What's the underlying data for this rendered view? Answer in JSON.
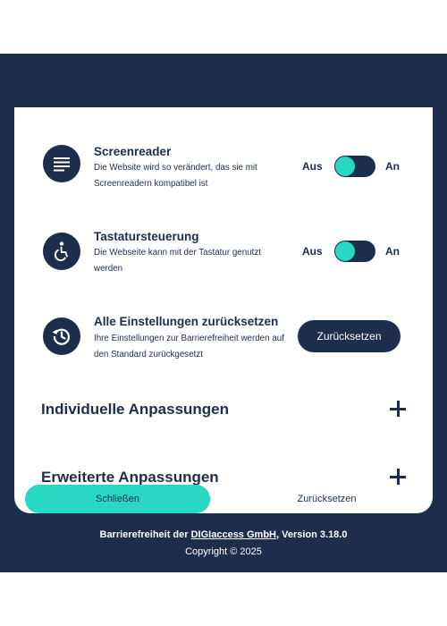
{
  "settings": {
    "screenreader": {
      "title": "Screenreader",
      "description": "Die Website wird so verändert, das sie mit Screenreadern kompatibel ist",
      "off_label": "Aus",
      "on_label": "An"
    },
    "keyboard": {
      "title": "Tastatursteuerung",
      "description": "Die Webseite kann mit der Tastatur genutzt werden",
      "off_label": "Aus",
      "on_label": "An"
    },
    "reset_all": {
      "title": "Alle Einstellungen zurücksetzen",
      "description": "Ihre Einstellungen zur Barrierefreiheit werden auf den Standard zurückgesetzt",
      "button_label": "Zurücksetzen"
    }
  },
  "sections": [
    {
      "label": "Individuelle Anpassungen"
    },
    {
      "label": "Erweiterte Anpassungen"
    }
  ],
  "actions": {
    "close_label": "Schließen",
    "reset_label": "Zurücksetzen"
  },
  "footer": {
    "prefix": "Barrierefreiheit der ",
    "company": "DIGIaccess GmbH",
    "suffix": ", Version 3.18.0",
    "copyright": "Copyright © 2025"
  },
  "colors": {
    "navy": "#1d2e4d",
    "accent": "#28d8c4",
    "white": "#ffffff"
  },
  "icons": {
    "screenreader": "text-lines-icon",
    "keyboard": "wheelchair-icon",
    "reset_all": "history-reset-icon",
    "expand": "plus-icon"
  }
}
